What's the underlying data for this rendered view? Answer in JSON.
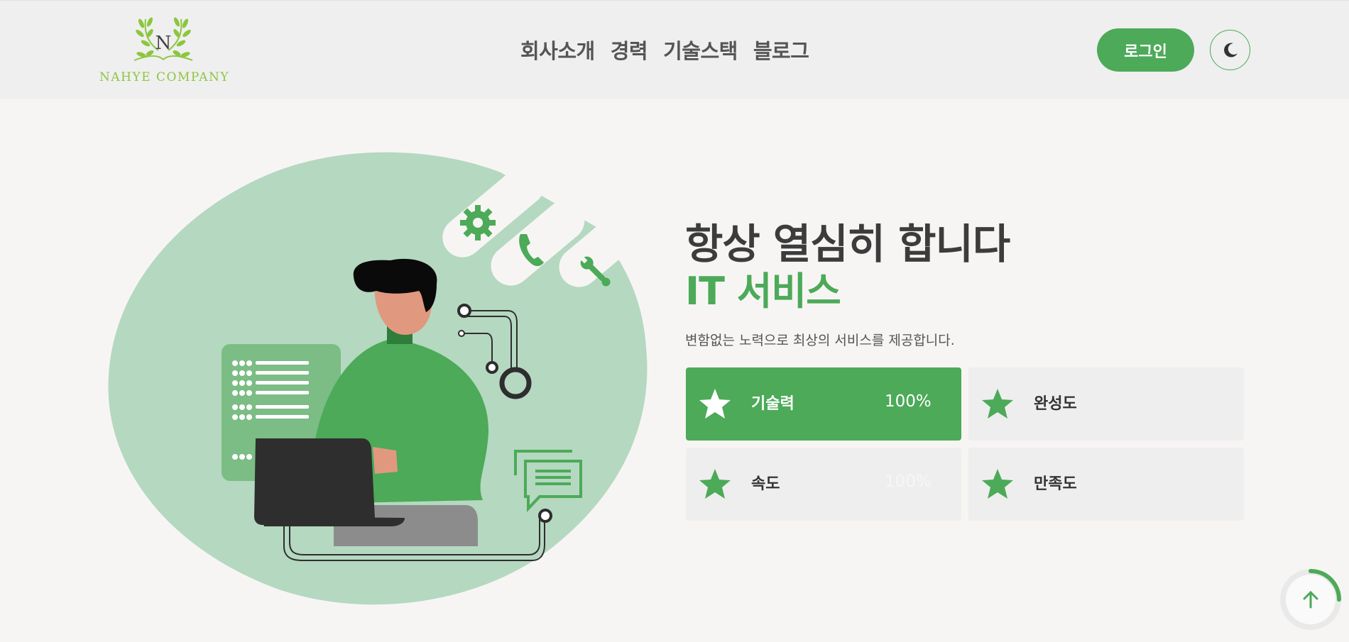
{
  "brand": {
    "logo_text": "NAHYE COMPANY",
    "logo_letter": "N"
  },
  "nav": {
    "items": [
      "회사소개",
      "경력",
      "기술스택",
      "블로그"
    ]
  },
  "header": {
    "login_label": "로그인",
    "theme_icon": "moon-icon"
  },
  "hero": {
    "title": "항상 열심히 합니다",
    "subtitle": "IT 서비스",
    "description": "변함없는 노력으로 최상의 서비스를 제공합니다."
  },
  "stats": [
    {
      "label": "기술력",
      "value": "100%",
      "active": true
    },
    {
      "label": "완성도",
      "value": "",
      "active": false
    },
    {
      "label": "속도",
      "value": "100%",
      "active": false
    },
    {
      "label": "만족도",
      "value": "",
      "active": false
    }
  ],
  "scroll_top": {
    "icon": "arrow-up-icon",
    "progress_percent": 25
  },
  "colors": {
    "accent": "#4caa58",
    "accent_light": "#b5d8c0",
    "header_bg": "#efefef",
    "page_bg": "#f7f5f4"
  }
}
